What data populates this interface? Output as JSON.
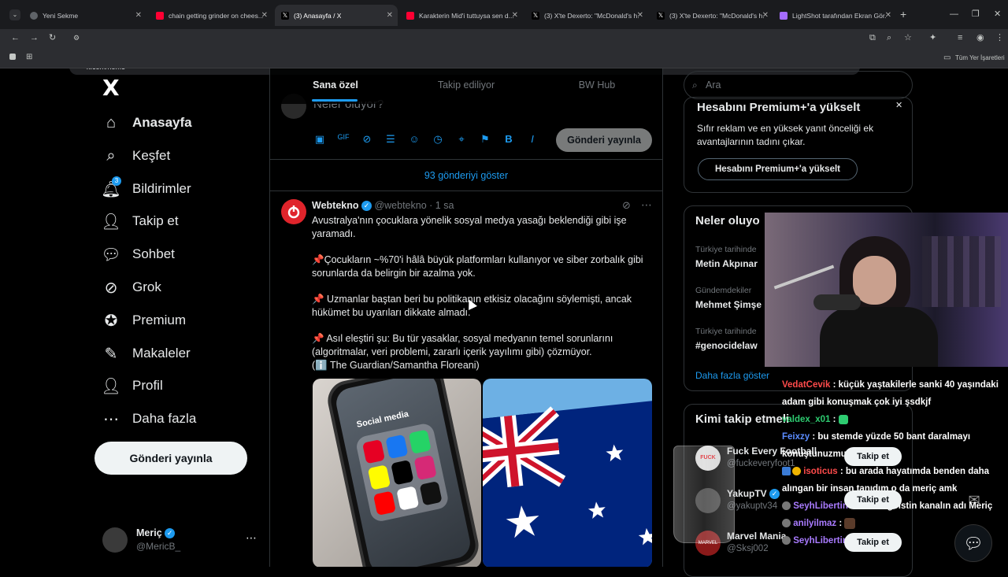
{
  "browser": {
    "tabs": [
      {
        "label": "Yeni Sekme",
        "color": "#8ab4f8"
      },
      {
        "label": "chain getting grinder on chees...",
        "color": "#ff0033"
      },
      {
        "label": "(3) Anasayfa / X",
        "color": "#ffffff"
      },
      {
        "label": "Karakterin Mid'i tuttuysa sen d...",
        "color": "#ff0033"
      },
      {
        "label": "(3) X'te Dexerto: \"McDonald's h...",
        "color": "#ffffff"
      },
      {
        "label": "(3) X'te Dexerto: \"McDonald's h...",
        "color": "#ffffff"
      },
      {
        "label": "LightShot tarafından Ekran Gör...",
        "color": "#a56cff"
      }
    ],
    "url": "x.com/home",
    "bookmarks_label": "Tüm Yer İşaretleri"
  },
  "nav": {
    "logo": "X",
    "items": [
      {
        "label": "Anasayfa",
        "icon": "home-icon"
      },
      {
        "label": "Keşfet",
        "icon": "search-icon"
      },
      {
        "label": "Bildirimler",
        "icon": "bell-icon",
        "badge": "3"
      },
      {
        "label": "Takip et",
        "icon": "person-plus-icon"
      },
      {
        "label": "Sohbet",
        "icon": "chat-icon"
      },
      {
        "label": "Grok",
        "icon": "grok-icon"
      },
      {
        "label": "Premium",
        "icon": "premium-icon"
      },
      {
        "label": "Makaleler",
        "icon": "article-icon"
      },
      {
        "label": "Profil",
        "icon": "profile-icon"
      },
      {
        "label": "Daha fazla",
        "icon": "more-icon"
      }
    ],
    "post_button": "Gönderi yayınla",
    "account": {
      "name": "Meriç",
      "handle": "@MericB_"
    }
  },
  "feed": {
    "tabs": [
      "Sana özel",
      "Takip ediliyor",
      "BW Hub"
    ],
    "compose_placeholder": "Neler oluyor?",
    "publish_button": "Gönderi yayınla",
    "show_more": "93 gönderiyi göster",
    "tweet": {
      "name": "Webtekno",
      "handle": "@webtekno",
      "time": "· 1 sa",
      "paragraphs": [
        "Avustralya'nın çocuklara yönelik sosyal medya yasağı beklendiği gibi işe yaramadı.",
        "📌Çocukların ~%70'i hâlâ büyük platformları kullanıyor ve siber zorbalık gibi sorunlarda da belirgin bir azalma yok.",
        "📌 Uzmanlar baştan beri bu politikanın etkisiz olacağını söylemişti, ancak hükümet bu uyarıları dikkate almadı.",
        "📌 Asıl eleştiri şu: Bu tür yasaklar, sosyal medyanın temel sorunlarını (algoritmalar, veri problemi, zararlı içerik yayılımı gibi) çözmüyor.",
        "(ℹ️ The Guardian/Samantha Floreani)"
      ],
      "media_phone_label": "Social media"
    }
  },
  "sidebar": {
    "search_placeholder": "Ara",
    "premium": {
      "title": "Hesabını Premium+'a yükselt",
      "body": "Sıfır reklam ve en yüksek yanıt önceliği ek avantajlarının tadını çıkar.",
      "button": "Hesabını Premium+'a yükselt"
    },
    "trends": {
      "title": "Neler oluyo",
      "items": [
        {
          "sub": "Türkiye tarihinde",
          "title": "Metin Akpınar"
        },
        {
          "sub": "Gündemdekiler",
          "title": "Mehmet Şimşe"
        },
        {
          "sub": "Türkiye tarihinde",
          "title": "#genocidelaw"
        }
      ],
      "more": "Daha fazla göster"
    },
    "who_to_follow": {
      "title": "Kimi takip etmeli",
      "items": [
        {
          "name": "Fuck Every Football",
          "handle": "@fuckeveryfoot1",
          "button": "Takip et"
        },
        {
          "name": "YakupTV",
          "handle": "@yakuptv34",
          "button": "Takip et"
        },
        {
          "name": "Marvel Mania",
          "handle": "@Sksj002",
          "button": "Takip et"
        }
      ]
    }
  },
  "stream_chat": [
    {
      "user": "VedatCevik",
      "color": "#ff4b4b",
      "msg": ": küçük yaştakilerle sanki 40 yaşındaki adam gibi konuşmak çok iyi şsdkjf"
    },
    {
      "user": "valdex_x01",
      "color": "#2ecc71",
      "msg": ":"
    },
    {
      "user": "Feixzy",
      "color": "#5b8cff",
      "msg": ": bu stemde yüzde 50 bant daralmayı konuştunuzmu"
    },
    {
      "user": "isoticus",
      "color": "#ff4b4b",
      "msg": ": bu arada hayatımda benden daha alıngan bir insan tanıdım o da meriç amk"
    },
    {
      "user": "SeyhLibertin",
      "color": "#a97bff",
      "msg": ": tabiki egoistin kanalın adı Meriç"
    },
    {
      "user": "anilyilmaz",
      "color": "#a97bff",
      "msg": ":"
    },
    {
      "user": "SeyhLibertin",
      "color": "#a97bff",
      "msg": ":"
    }
  ]
}
